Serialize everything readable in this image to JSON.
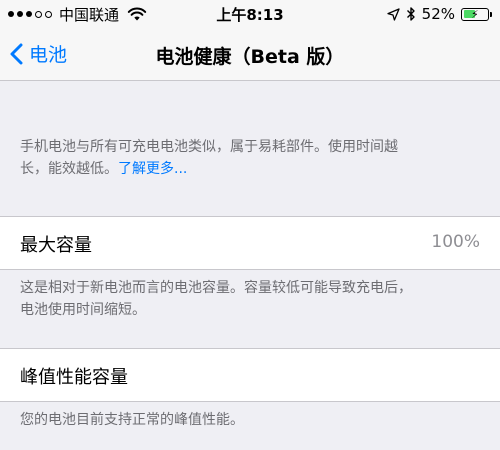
{
  "status_bar": {
    "carrier": "中国联通",
    "time": "上午8:13",
    "battery_percent": "52%",
    "battery_level": 0.52
  },
  "nav": {
    "back_label": "电池",
    "title": "电池健康（Beta 版）"
  },
  "intro": {
    "line1": "手机电池与所有可充电电池类似，属于易耗部件。使用时间越",
    "line2": "长，能效越低。",
    "link": "了解更多..."
  },
  "max_capacity": {
    "label": "最大容量",
    "value": "100%",
    "desc_line1": "这是相对于新电池而言的电池容量。容量较低可能导致充电后，",
    "desc_line2": "电池使用时间缩短。"
  },
  "peak_performance": {
    "label": "峰值性能容量",
    "desc": "您的电池目前支持正常的峰值性能。"
  }
}
